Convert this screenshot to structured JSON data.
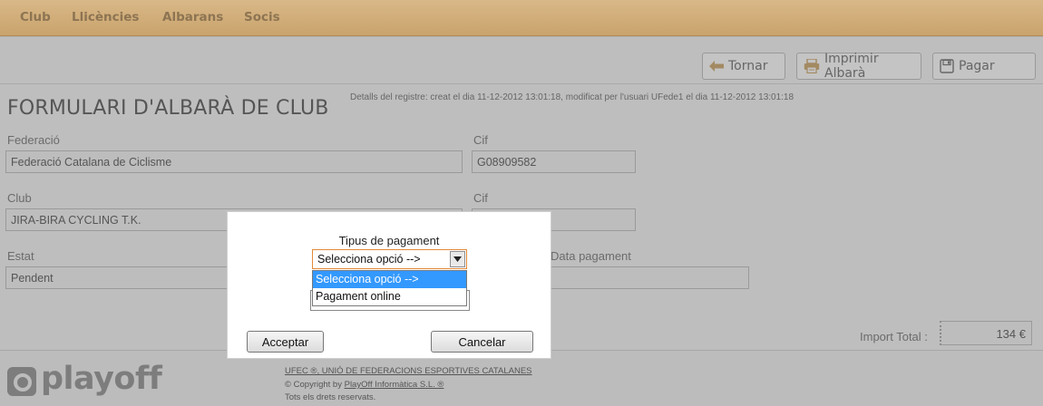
{
  "nav": {
    "items": [
      "Club",
      "Llicències",
      "Albarans",
      "Socis"
    ]
  },
  "toolbar": {
    "back_label": "Tornar",
    "print_label": "Imprimir Albarà",
    "pay_label": "Pagar"
  },
  "form": {
    "title": "FORMULARI D'ALBARÀ DE CLUB",
    "details": "Detalls del registre: creat el dia 11-12-2012 13:01:18, modificat per l'usuari UFede1 el dia 11-12-2012 13:01:18",
    "federacio_label": "Federació",
    "federacio_value": "Federació Catalana de Ciclisme",
    "cif1_label": "Cif",
    "cif1_value": "G08909582",
    "club_label": "Club",
    "club_value": "JIRA-BIRA CYCLING T.K.",
    "cif2_label": "Cif",
    "estat_label": "Estat",
    "estat_value": "Pendent",
    "data_pagament_label": "Data pagament",
    "import_label": "Import Total :",
    "import_value": "134 €"
  },
  "modal": {
    "label": "Tipus de pagament",
    "selected": "Selecciona opció -->",
    "options": [
      "Selecciona opció -->",
      "Pagament online"
    ],
    "accept_label": "Acceptar",
    "cancel_label": "Cancelar"
  },
  "footer": {
    "logo": "playoff",
    "org": "UFEC ®, UNIÓ DE FEDERACIONS ESPORTIVES CATALANES",
    "copyright_prefix": "© Copyright by ",
    "copyright_link": "PlayOff Informàtica S.L. ®",
    "rights": "Tots els drets reservats."
  },
  "colors": {
    "nav_bg": "#c9a36c",
    "overlay_gray": "#bebebe",
    "selected_option": "#3399ff",
    "select_border": "#e28a3a"
  },
  "icons": {
    "back": "arrow-left-icon",
    "print": "printer-icon",
    "pay": "save-icon",
    "select_arrow": "triangle-down-icon",
    "logo": "playoff-logo-icon"
  }
}
